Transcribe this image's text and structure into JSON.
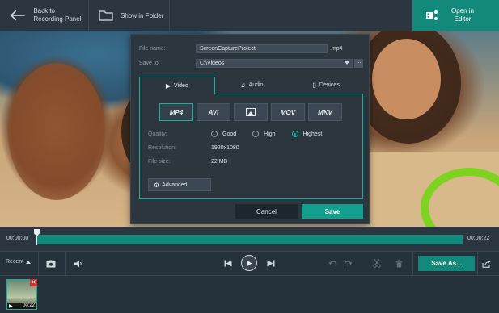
{
  "topbar": {
    "back_label": "Back to\nRecording Panel",
    "folder_label": "Show in Folder",
    "editor_label": "Open in\nEditor"
  },
  "dialog": {
    "file_name_label": "File name:",
    "file_name_value": "ScreenCaptureProject",
    "file_ext": ".mp4",
    "save_to_label": "Save to:",
    "save_to_value": "C:\\Videos",
    "browse_label": "...",
    "tabs": [
      {
        "label": "Video",
        "icon": "film-icon",
        "active": true
      },
      {
        "label": "Audio",
        "icon": "music-note-icon",
        "active": false
      },
      {
        "label": "Devices",
        "icon": "phone-icon",
        "active": false
      }
    ],
    "formats": [
      {
        "label": "MP4",
        "selected": true
      },
      {
        "label": "AVI",
        "selected": false
      },
      {
        "label": "",
        "icon": "image-icon",
        "selected": false
      },
      {
        "label": "MOV",
        "selected": false
      },
      {
        "label": "MKV",
        "selected": false
      }
    ],
    "quality_label": "Quality:",
    "quality_options": [
      "Good",
      "High",
      "Highest"
    ],
    "quality_selected": "Highest",
    "resolution_label": "Resolution:",
    "resolution_value": "1920x1080",
    "filesize_label": "File size:",
    "filesize_value": "22 MB",
    "advanced_label": "Advanced",
    "cancel_label": "Cancel",
    "save_label": "Save"
  },
  "timeline": {
    "start_time": "00:00:00",
    "end_time": "00:00:22",
    "position": 0
  },
  "controls": {
    "recent_label": "Recent",
    "save_as_label": "Save As..."
  },
  "thumbnails": [
    {
      "duration": "00:22"
    }
  ],
  "colors": {
    "accent": "#12897a",
    "accent_bright": "#14b39f",
    "background": "#25313b"
  }
}
